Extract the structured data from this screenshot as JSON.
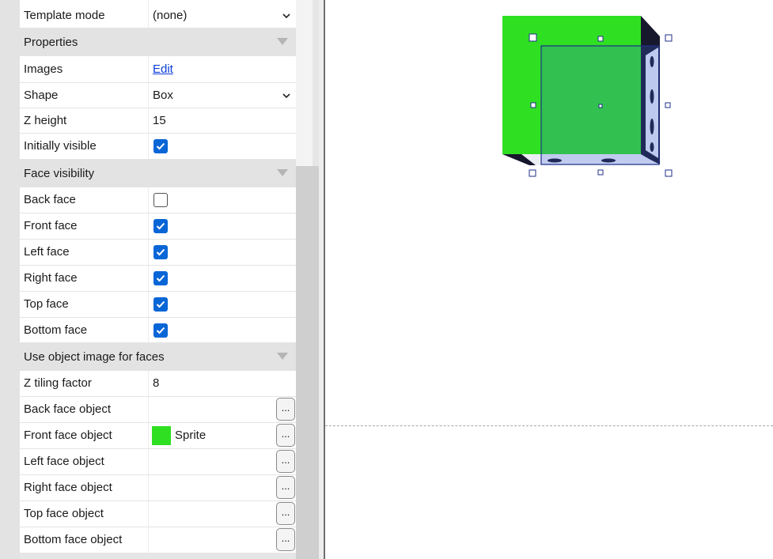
{
  "properties_panel": {
    "rows_top": [
      {
        "label": "Template mode",
        "value": "(none)"
      }
    ],
    "section_properties": "Properties",
    "properties": [
      {
        "label": "Images",
        "value": "Edit"
      },
      {
        "label": "Shape",
        "value": "Box"
      },
      {
        "label": "Z height",
        "value": "15"
      },
      {
        "label": "Initially visible",
        "checked": true
      }
    ],
    "section_face_visibility": "Face visibility",
    "face_visibility": [
      {
        "label": "Back face",
        "checked": false
      },
      {
        "label": "Front face",
        "checked": true
      },
      {
        "label": "Left face",
        "checked": true
      },
      {
        "label": "Right face",
        "checked": true
      },
      {
        "label": "Top face",
        "checked": true
      },
      {
        "label": "Bottom face",
        "checked": true
      }
    ],
    "section_object_image": "Use object image for faces",
    "object_image": [
      {
        "label": "Z tiling factor",
        "value": "8"
      },
      {
        "label": "Back face object",
        "value": ""
      },
      {
        "label": "Front face object",
        "value": "Sprite",
        "swatch_color": "#2fe022"
      },
      {
        "label": "Left face object",
        "value": ""
      },
      {
        "label": "Right face object",
        "value": ""
      },
      {
        "label": "Top face object",
        "value": ""
      },
      {
        "label": "Bottom face object",
        "value": ""
      }
    ],
    "ellipsis_label": "...",
    "accent_color": "#0866d6"
  },
  "canvas": {
    "object_front_color": "#2fe022",
    "selection_color": "#1f2f8a"
  }
}
